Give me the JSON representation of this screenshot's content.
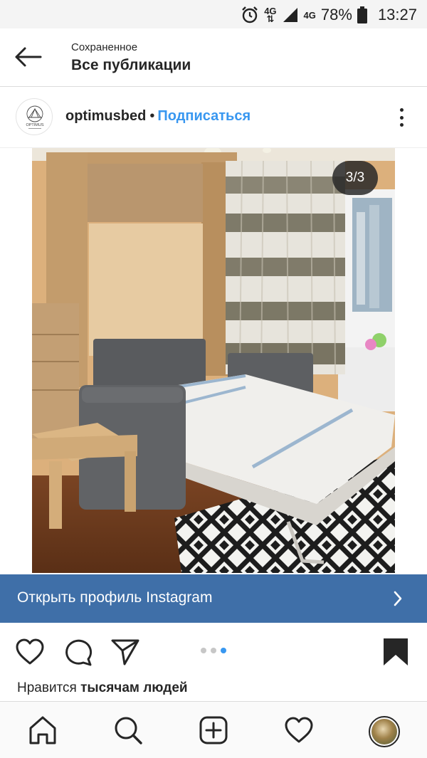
{
  "status_bar": {
    "network_1": "4G",
    "network_2": "4G",
    "battery_pct": "78%",
    "time": "13:27"
  },
  "header": {
    "subtitle": "Сохраненное",
    "title": "Все публикации"
  },
  "post": {
    "username": "optimusbed",
    "separator": "•",
    "follow_label": "Подписаться",
    "avatar_label": "OPTIMUS",
    "image_counter": "3/3",
    "carousel": {
      "total": 3,
      "current": 3
    }
  },
  "banner": {
    "label": "Открыть профиль Instagram"
  },
  "likes": {
    "prefix": "Нравится",
    "count_text": "тысячам людей"
  },
  "icons": {
    "back": "arrow-left-icon",
    "more": "more-vertical-icon",
    "like": "heart-icon",
    "comment": "comment-icon",
    "share": "send-icon",
    "save": "bookmark-icon",
    "home": "home-icon",
    "search": "search-icon",
    "add": "add-post-icon",
    "activity": "heart-icon"
  },
  "colors": {
    "accent": "#3897f0",
    "banner": "#3f6fa8",
    "text": "#262626"
  }
}
